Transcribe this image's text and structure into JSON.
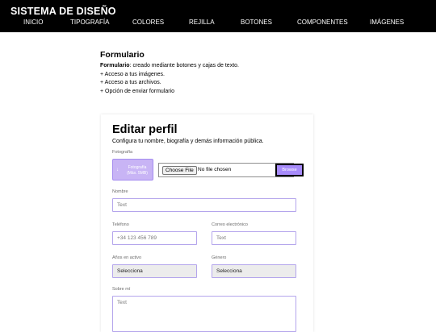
{
  "header": {
    "brand": "SISTEMA DE DISEÑO",
    "nav": [
      "INICIO",
      "TIPOGRAFÍA",
      "COLORES",
      "REJILLA",
      "BOTONES",
      "COMPONENTES",
      "IMÁGENES"
    ]
  },
  "intro": {
    "heading": "Formulario",
    "desc_bold": "Formulario",
    "desc_rest": ": creado mediante botones y cajas de texto.",
    "items": [
      "+ Acceso a tus imágenes.",
      "+ Acceso a tus archivos.",
      "+ Opción de enviar formulario"
    ]
  },
  "card": {
    "title": "Editar perfil",
    "subtitle": "Configura tu nombre, biografía y demás información pública.",
    "photo": {
      "label": "Fotografía",
      "button_arrow": "↓",
      "button_line1": "Fotografía",
      "button_line2": "(Máx. 5MB)",
      "choose_label": "Choose File",
      "file_status": "No file chosen",
      "browse_label": "Browse"
    },
    "name": {
      "label": "Nombre",
      "placeholder": "Text"
    },
    "phone": {
      "label": "Teléfono",
      "placeholder": "+34 123 456 789"
    },
    "email": {
      "label": "Correo electrónico",
      "placeholder": "Text"
    },
    "years": {
      "label": "Años en activo",
      "value": "Selecciona"
    },
    "gender": {
      "label": "Género",
      "value": "Selecciona"
    },
    "about": {
      "label": "Sobre mí",
      "placeholder": "Text"
    }
  },
  "colors": {
    "topbar": "#000000",
    "accent": "#a78bfa",
    "photo_button": "#c8b4f5",
    "input_border": "#b4a5ec"
  }
}
